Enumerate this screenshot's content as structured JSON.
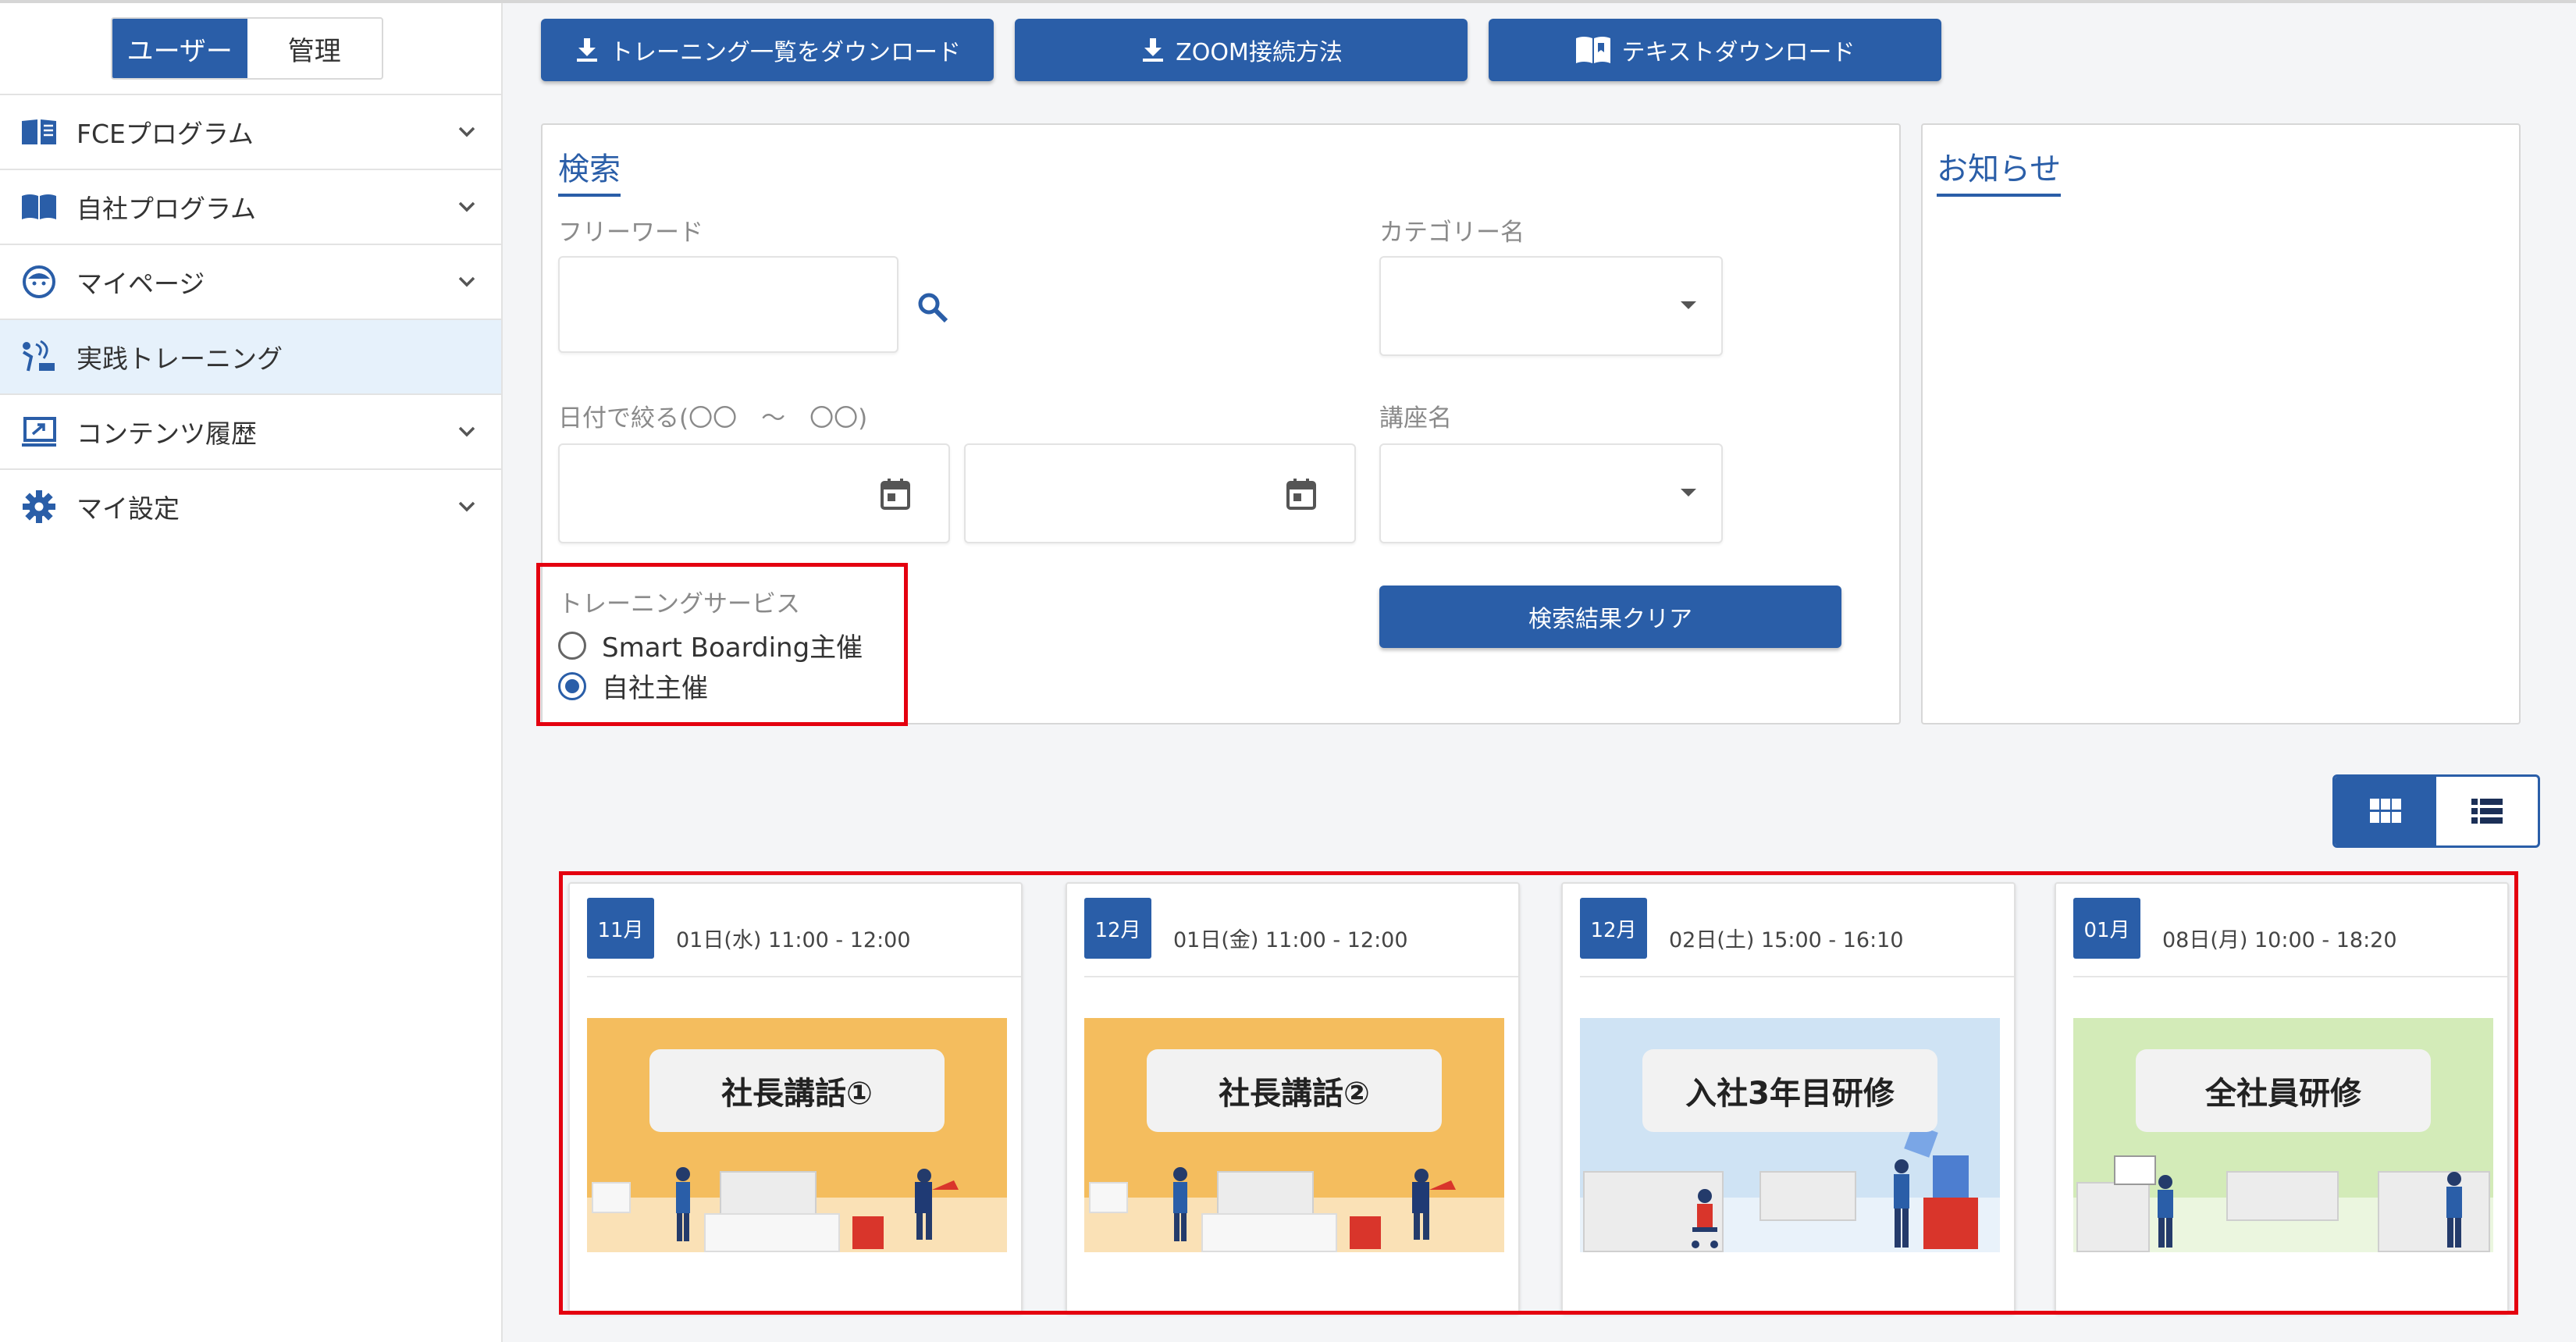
{
  "sidebar": {
    "role_toggle": {
      "user": "ユーザー",
      "admin": "管理"
    },
    "items": [
      {
        "label": "FCEプログラム",
        "icon": "book-open-icon",
        "has_chevron": true
      },
      {
        "label": "自社プログラム",
        "icon": "book-icon",
        "has_chevron": true
      },
      {
        "label": "マイページ",
        "icon": "face-icon",
        "has_chevron": true
      },
      {
        "label": "実践トレーニング",
        "icon": "training-icon",
        "has_chevron": false,
        "active": true
      },
      {
        "label": "コンテンツ履歴",
        "icon": "history-icon",
        "has_chevron": true
      },
      {
        "label": "マイ設定",
        "icon": "gear-icon",
        "has_chevron": true
      }
    ]
  },
  "toolbar": {
    "download_list": "トレーニング一覧をダウンロード",
    "zoom_howto": "ZOOM接続方法",
    "text_download": "テキストダウンロード"
  },
  "search": {
    "title": "検索",
    "freeword_label": "フリーワード",
    "freeword_value": "",
    "category_label": "カテゴリー名",
    "category_value": "",
    "date_label": "日付で絞る(〇〇　～　〇〇)",
    "date_from": "",
    "date_to": "",
    "course_label": "講座名",
    "course_value": "",
    "service_label": "トレーニングサービス",
    "service_options": [
      {
        "label": "Smart Boarding主催",
        "checked": false
      },
      {
        "label": "自社主催",
        "checked": true
      }
    ],
    "clear_button": "検索結果クリア"
  },
  "notice": {
    "title": "お知らせ"
  },
  "view_toggle": {
    "selected": "grid"
  },
  "trainings": [
    {
      "month": "11月",
      "date": "01日(水) 11:00 - 12:00",
      "title": "社長講話①",
      "bg": "#f4bd5e"
    },
    {
      "month": "12月",
      "date": "01日(金) 11:00 - 12:00",
      "title": "社長講話②",
      "bg": "#f4bd5e"
    },
    {
      "month": "12月",
      "date": "02日(土) 15:00 - 16:10",
      "title": "入社3年目研修",
      "bg": "#cfe3f4"
    },
    {
      "month": "01月",
      "date": "08日(月) 10:00 - 18:20",
      "title": "全社員研修",
      "bg": "#d3ebb8"
    }
  ],
  "colors": {
    "primary": "#2a5ea8",
    "highlight": "#e4000f",
    "active_menu_bg": "#e6f1fb"
  }
}
